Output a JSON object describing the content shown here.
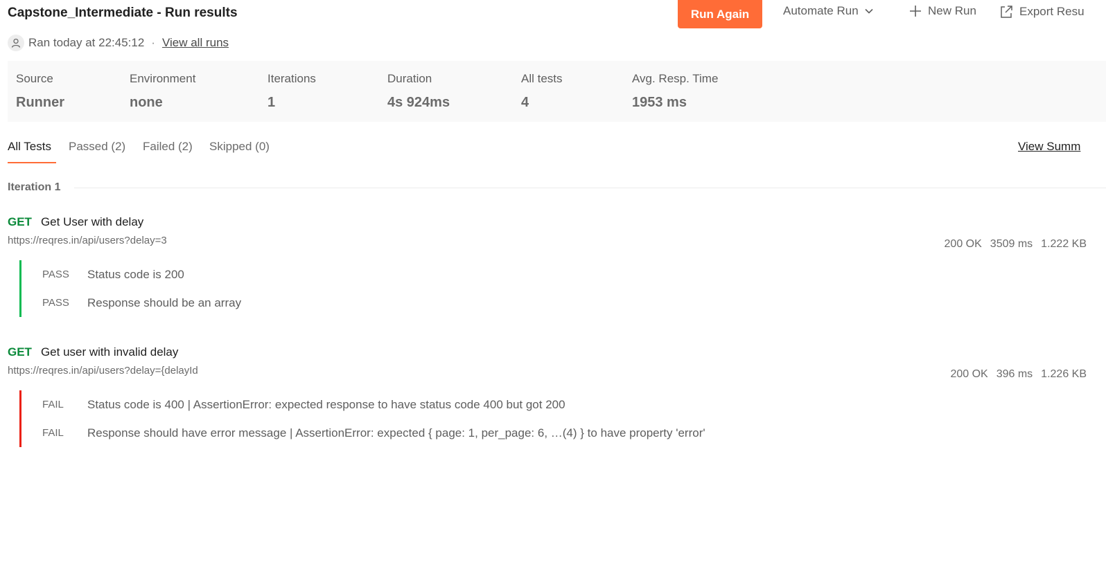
{
  "header": {
    "title": "Capstone_Intermediate - Run results",
    "run_again": "Run Again",
    "automate_run": "Automate Run",
    "new_run": "New Run",
    "export_results": "Export Resu",
    "accent_color": "#ff6c37"
  },
  "meta": {
    "ran_at": "Ran today at 22:45:12",
    "separator": "·",
    "view_all_runs": "View all runs"
  },
  "stats": [
    {
      "label": "Source",
      "value": "Runner"
    },
    {
      "label": "Environment",
      "value": "none"
    },
    {
      "label": "Iterations",
      "value": "1"
    },
    {
      "label": "Duration",
      "value": "4s 924ms"
    },
    {
      "label": "All tests",
      "value": "4"
    },
    {
      "label": "Avg. Resp. Time",
      "value": "1953 ms"
    }
  ],
  "tabs": [
    "All Tests",
    "Passed (2)",
    "Failed (2)",
    "Skipped (0)"
  ],
  "view_summary": "View Summ",
  "iteration_label": "Iteration 1",
  "requests": [
    {
      "method": "GET",
      "name": "Get User with delay",
      "url": "https://reqres.in/api/users?delay=3",
      "status": "200 OK",
      "time": "3509 ms",
      "size": "1.222 KB",
      "tests": [
        {
          "status": "PASS",
          "text": "Status code is 200"
        },
        {
          "status": "PASS",
          "text": "Response should be an array"
        }
      ]
    },
    {
      "method": "GET",
      "name": "Get user with invalid delay",
      "url": "https://reqres.in/api/users?delay={delayId",
      "status": "200 OK",
      "time": "396 ms",
      "size": "1.226 KB",
      "tests": [
        {
          "status": "FAIL",
          "text": "Status code is 400 | AssertionError: expected response to have status code 400 but got 200"
        },
        {
          "status": "FAIL",
          "text": "Response should have error message | AssertionError: expected { page: 1, per_page: 6, …(4) } to have property 'error'"
        }
      ]
    }
  ],
  "colors": {
    "pass": "#0cbb52",
    "fail": "#eb2013",
    "method_get": "#0b8a3a"
  }
}
